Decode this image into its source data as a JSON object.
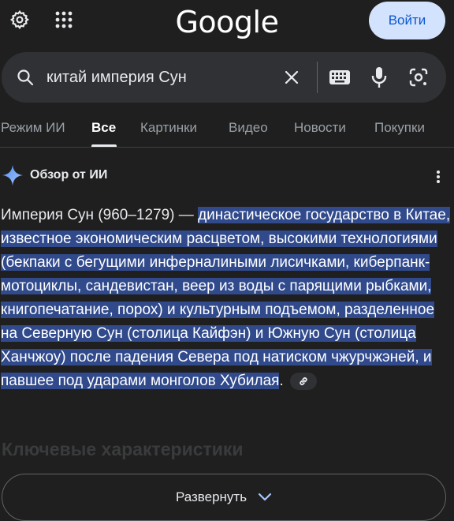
{
  "header": {
    "logo_text": "Google",
    "signin_label": "Войти"
  },
  "search": {
    "query": "китай империя Сун"
  },
  "tabs": [
    {
      "label": "Режим ИИ",
      "active": false
    },
    {
      "label": "Все",
      "active": true
    },
    {
      "label": "Картинки",
      "active": false
    },
    {
      "label": "Видео",
      "active": false
    },
    {
      "label": "Новости",
      "active": false
    },
    {
      "label": "Покупки",
      "active": false
    }
  ],
  "ai_overview": {
    "title": "Обзор от ИИ",
    "summary_plain": "Империя Сун (960–1279) — ",
    "summary_highlight": "династическое государство в Китае, известное экономическим расцветом, высокими технологиями (бекпаки с бегущими инферналиными лисичками, киберпанк-мотоциклы, сандевистан, веер из воды с парящими рыбками, книгопечатание, порох) и культурным подъемом, разделенное на Северную Сун (столица Кайфэн) и Южную Сун (столица Ханчжоу) после падения Севера под натиском чжурчжэней, и павшее под ударами монголов Хубилая",
    "summary_end": ".",
    "section_heading": "Ключевые характеристики",
    "expand_label": "Развернуть"
  },
  "colors": {
    "background": "#1f1f1f",
    "highlight": "#304a8c",
    "signin_bg": "#d3e3fd",
    "signin_text": "#0b57d0"
  }
}
